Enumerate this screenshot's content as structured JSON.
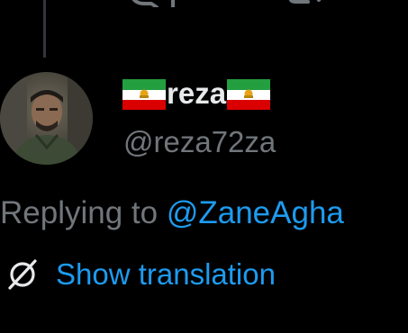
{
  "colors": {
    "background": "#000000",
    "primary_text": "#e7e9ea",
    "secondary_text": "#71767b",
    "link": "#1d9bf0",
    "thread_line": "#333639"
  },
  "top_actions": [
    {
      "icon": "reply-icon"
    },
    {
      "icon": "retweet-icon"
    }
  ],
  "author": {
    "display_name": "reza",
    "handle": "@reza72za",
    "name_icons": [
      "iran-flag-icon",
      "iran-flag-icon"
    ],
    "avatar_icon": "avatar"
  },
  "reply": {
    "prefix": "Replying to",
    "mention": "@ZaneAgha"
  },
  "translation": {
    "icon": "globe-slash-icon",
    "label": "Show translation"
  }
}
